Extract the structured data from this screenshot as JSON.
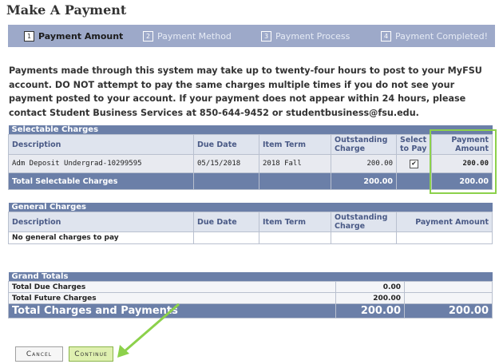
{
  "page": {
    "title": "Make A Payment"
  },
  "steps": [
    {
      "num": "1",
      "label": "Payment Amount"
    },
    {
      "num": "2",
      "label": "Payment Method"
    },
    {
      "num": "3",
      "label": "Payment Process"
    },
    {
      "num": "4",
      "label": "Payment Completed!"
    }
  ],
  "notice": "Payments made through this system may take up to twenty-four hours to post to your MyFSU account. DO NOT attempt to pay the same charges multiple times if you do not see your payment posted to your account. If your payment does not appear within 24 hours, please contact Student Business Services at 850-644-9452 or studentbusiness@fsu.edu.",
  "selectable": {
    "caption": "Selectable Charges",
    "headers": {
      "description": "Description",
      "due_date": "Due Date",
      "item_term": "Item Term",
      "outstanding": "Outstanding Charge",
      "select": "Select to Pay",
      "payment": "Payment Amount"
    },
    "row": {
      "description": "Adm Deposit Undergrad-10299595",
      "due_date": "05/15/2018",
      "item_term": "2018 Fall",
      "outstanding": "200.00",
      "selected": true,
      "payment": "200.00"
    },
    "total": {
      "label": "Total Selectable Charges",
      "outstanding": "200.00",
      "payment": "200.00"
    }
  },
  "general": {
    "caption": "General Charges",
    "headers": {
      "description": "Description",
      "due_date": "Due Date",
      "item_term": "Item Term",
      "outstanding": "Outstanding Charge",
      "payment": "Payment Amount"
    },
    "empty": "No general charges to pay"
  },
  "grand": {
    "caption": "Grand Totals",
    "due_label": "Total Due Charges",
    "due_value": "0.00",
    "future_label": "Total Future Charges",
    "future_value": "200.00",
    "total_label": "Total Charges and Payments",
    "total_value": "200.00",
    "total_payment": "200.00"
  },
  "buttons": {
    "cancel": "Cancel",
    "continue": "Continue"
  },
  "colors": {
    "header_bar": "#6b7fa8",
    "step_bar": "#9da9c9",
    "highlight": "#8cd14b",
    "continue_bg": "#dff0b0"
  }
}
